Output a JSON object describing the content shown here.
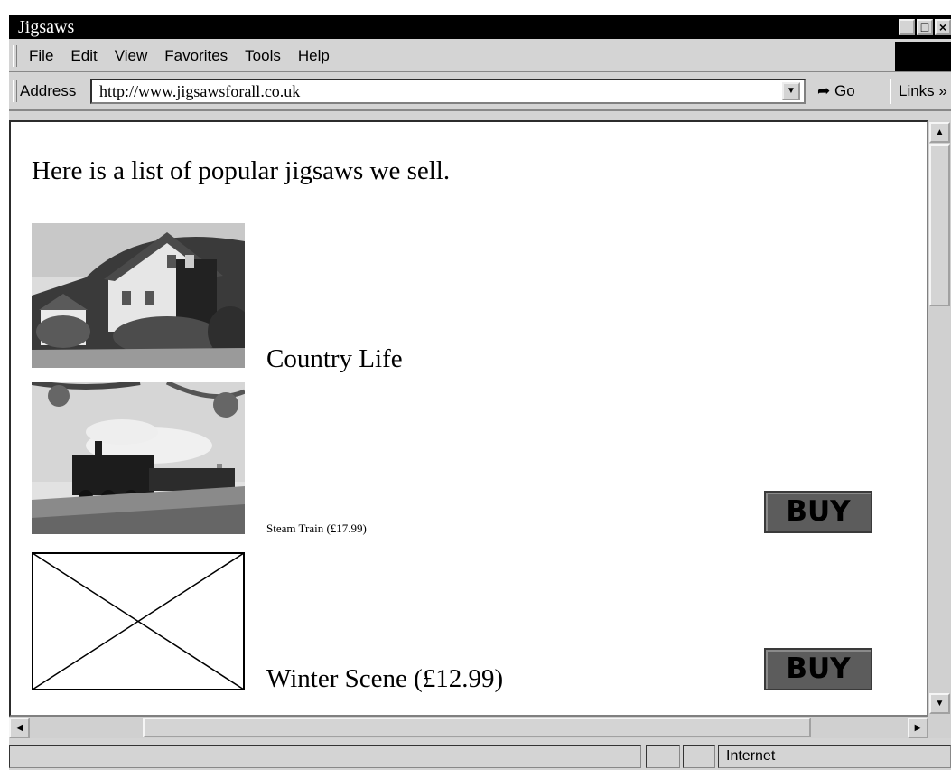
{
  "window": {
    "title": "Jigsaws"
  },
  "menu": [
    "File",
    "Edit",
    "View",
    "Favorites",
    "Tools",
    "Help"
  ],
  "address": {
    "label": "Address",
    "url": "http://www.jigsawsforall.co.uk",
    "go_label": "Go",
    "links_label": "Links"
  },
  "page": {
    "heading": "Here is a list of popular jigsaws we sell.",
    "products": [
      {
        "caption": "Country Life",
        "image": "house-photo"
      },
      {
        "caption": "Steam Train (£17.99)",
        "image": "train-photo",
        "buy_label": "BUY"
      },
      {
        "caption": "Winter Scene (£12.99)",
        "image": "missing-image-placeholder",
        "buy_label": "BUY"
      }
    ]
  },
  "status": {
    "zone": "Internet"
  }
}
